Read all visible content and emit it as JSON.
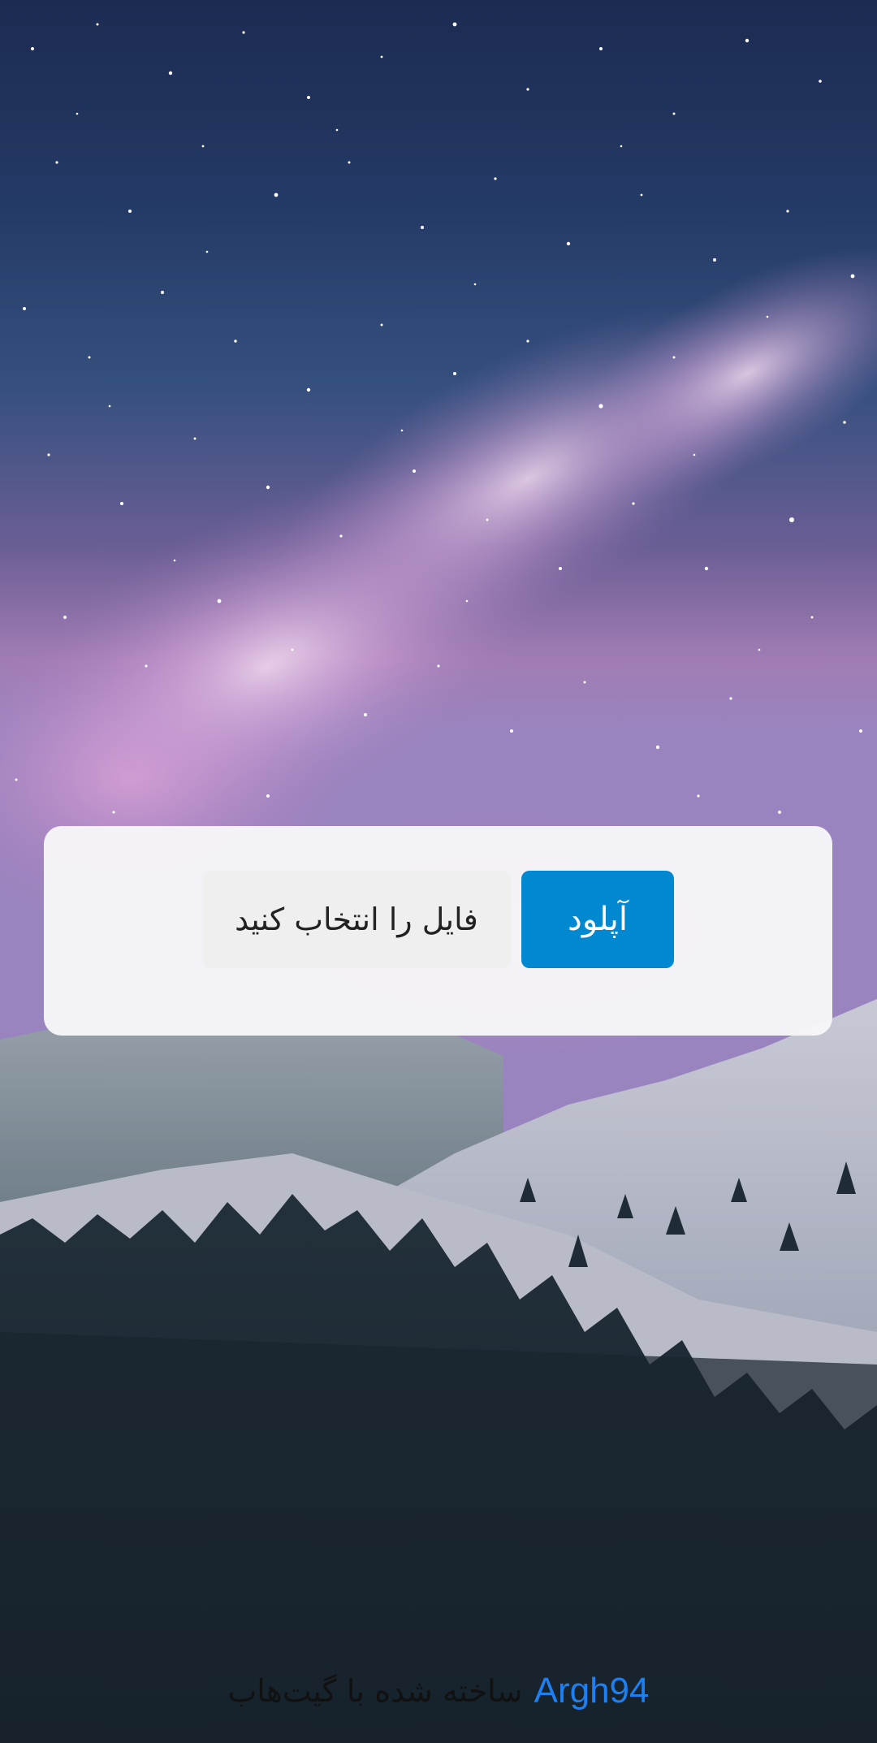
{
  "upload_form": {
    "file_picker_label": "فایل را انتخاب کنید",
    "upload_button_label": "آپلود"
  },
  "footer": {
    "made_with_text": "ساخته شده با گیت‌هاب",
    "author_link": "Argh94"
  },
  "colors": {
    "accent": "#0288d1",
    "link": "#1e7ff0",
    "card_background": "#f8f8fa",
    "file_picker_background": "#efefef"
  },
  "icons": []
}
